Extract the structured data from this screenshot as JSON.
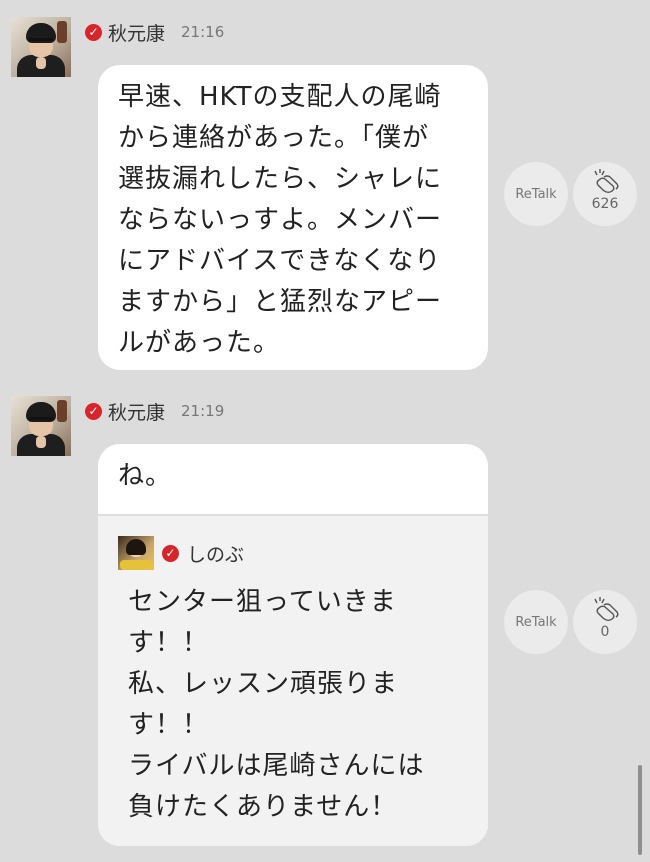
{
  "messages": [
    {
      "sender": "秋元康",
      "time": "21:16",
      "text": "早速、HKTの支配人の尾崎\nから連絡があった。「僕が\n選抜漏れしたら、シャレに\nならないっすよ。メンバー\nにアドバイスできなくなり\nますから」と猛烈なアピー\nルがあった。",
      "retalk_label": "ReTalk",
      "clap_count": "626"
    },
    {
      "sender": "秋元康",
      "time": "21:19",
      "text": "ね。",
      "quote": {
        "sender": "しのぶ",
        "text": "センター狙っていきま\nす！！\n私、レッスン頑張りま\nす！！\nライバルは尾崎さんには\n負けたくありません！"
      },
      "retalk_label": "ReTalk",
      "clap_count": "0"
    }
  ],
  "colors": {
    "background": "#dcdcdc",
    "bubble": "#ffffff",
    "verified": "#d6262c"
  },
  "icons": {
    "verified": "verified-check-icon",
    "clap": "clap-icon"
  }
}
